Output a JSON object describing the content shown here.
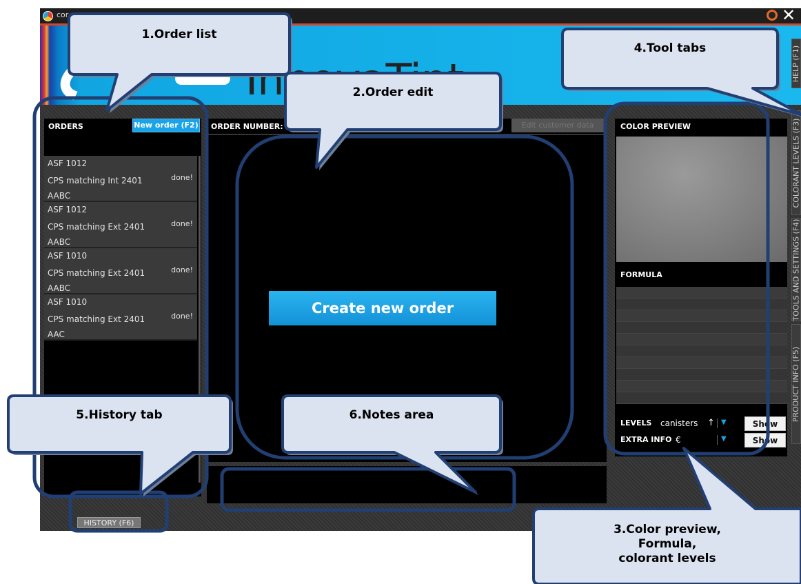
{
  "window": {
    "app_title": "cor",
    "brand_text": "InnovaTint"
  },
  "side_tabs": [
    {
      "label": "HELP (F1)"
    },
    {
      "label": "COLORANT LEVELS (F3)"
    },
    {
      "label": "TOOLS AND SETTINGS (F4)"
    },
    {
      "label": "PRODUCT INFO (F5)"
    }
  ],
  "orders": {
    "title": "ORDERS",
    "new_order_label": "New order (F2)",
    "items": [
      {
        "code": "ASF 1012",
        "name": "CPS matching Int 2401",
        "status": "done!",
        "base": "AABC"
      },
      {
        "code": "ASF 1012",
        "name": "CPS matching Ext 2401",
        "status": "done!",
        "base": "AABC"
      },
      {
        "code": "ASF 1010",
        "name": "CPS matching Ext 2401",
        "status": "done!",
        "base": "AABC"
      },
      {
        "code": "ASF 1010",
        "name": "CPS matching Ext 2401",
        "status": "done!",
        "base": "AAC"
      }
    ],
    "history_tab": "HISTORY (F6)"
  },
  "order_edit": {
    "order_number_label": "ORDER NUMBER:",
    "edit_customer_label": "Edit customer data",
    "create_order_label": "Create new order"
  },
  "right_panel": {
    "color_preview_label": "COLOR PREVIEW",
    "formula_label": "FORMULA",
    "levels_label": "LEVELS",
    "levels_value": "canisters",
    "levels_sort_icon": "arrow-up",
    "extra_info_label": "EXTRA INFO",
    "extra_info_value": "€",
    "show_label": "Show"
  },
  "callouts": {
    "order_list": "1.Order list",
    "order_edit": "2.Order edit",
    "color_preview_line1": "3.Color preview,",
    "color_preview_line2": "Formula,",
    "color_preview_line3": "colorant levels",
    "tool_tabs": "4.Tool tabs",
    "history_tab": "5.History tab",
    "notes_area": "6.Notes area"
  },
  "colors": {
    "accent_blue": "#1aa3e8",
    "callout_fill": "#dbe2f0",
    "callout_border": "#213f72",
    "callout_shadow": "#6f7f98"
  }
}
